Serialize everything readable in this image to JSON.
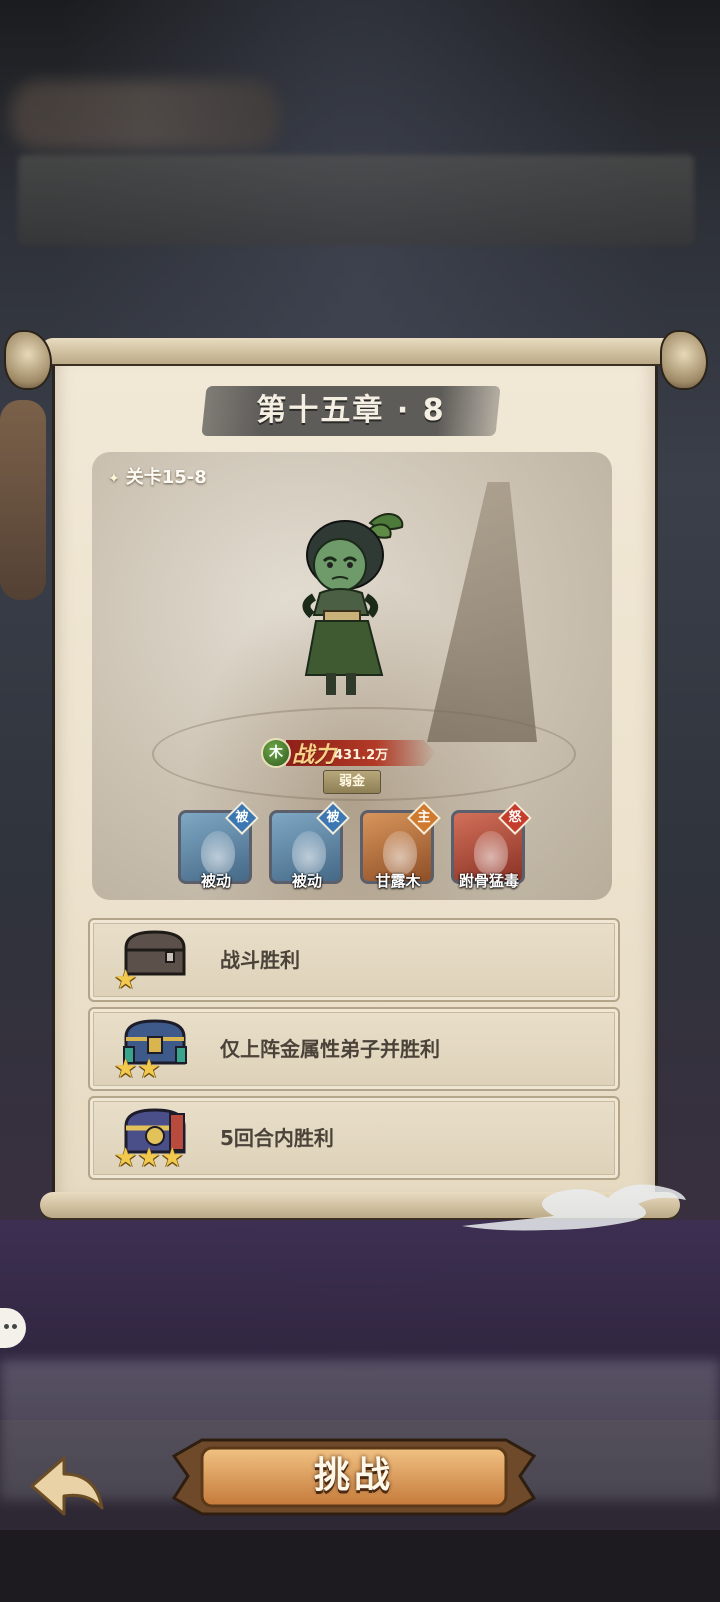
{
  "chapter_title": "第十五章 · 8",
  "stage": {
    "label": "关卡15-8",
    "element_badge": "木",
    "power_label": "战力",
    "power_value": "431.2万",
    "weakness": "弱金"
  },
  "skills": [
    {
      "name": "被动",
      "tag": "被",
      "color": "blue"
    },
    {
      "name": "被动",
      "tag": "被",
      "color": "blue"
    },
    {
      "name": "甘露木",
      "tag": "主",
      "color": "orange"
    },
    {
      "name": "跗骨猛毒",
      "tag": "怒",
      "color": "red"
    }
  ],
  "objectives": [
    {
      "text": "战斗胜利",
      "stars": 1,
      "chest": "plain-chest-icon"
    },
    {
      "text": "仅上阵金属性弟子并胜利",
      "stars": 2,
      "chest": "blue-chest-icon"
    },
    {
      "text": "5回合内胜利",
      "stars": 3,
      "chest": "ornate-chest-icon"
    }
  ],
  "buttons": {
    "challenge": "挑战",
    "back": "back-arrow-icon"
  },
  "colors": {
    "parchment": "#ece2cd",
    "power_red": "#b23a27",
    "star_gold": "#f2c94c",
    "button_orange": "#d99a55"
  }
}
